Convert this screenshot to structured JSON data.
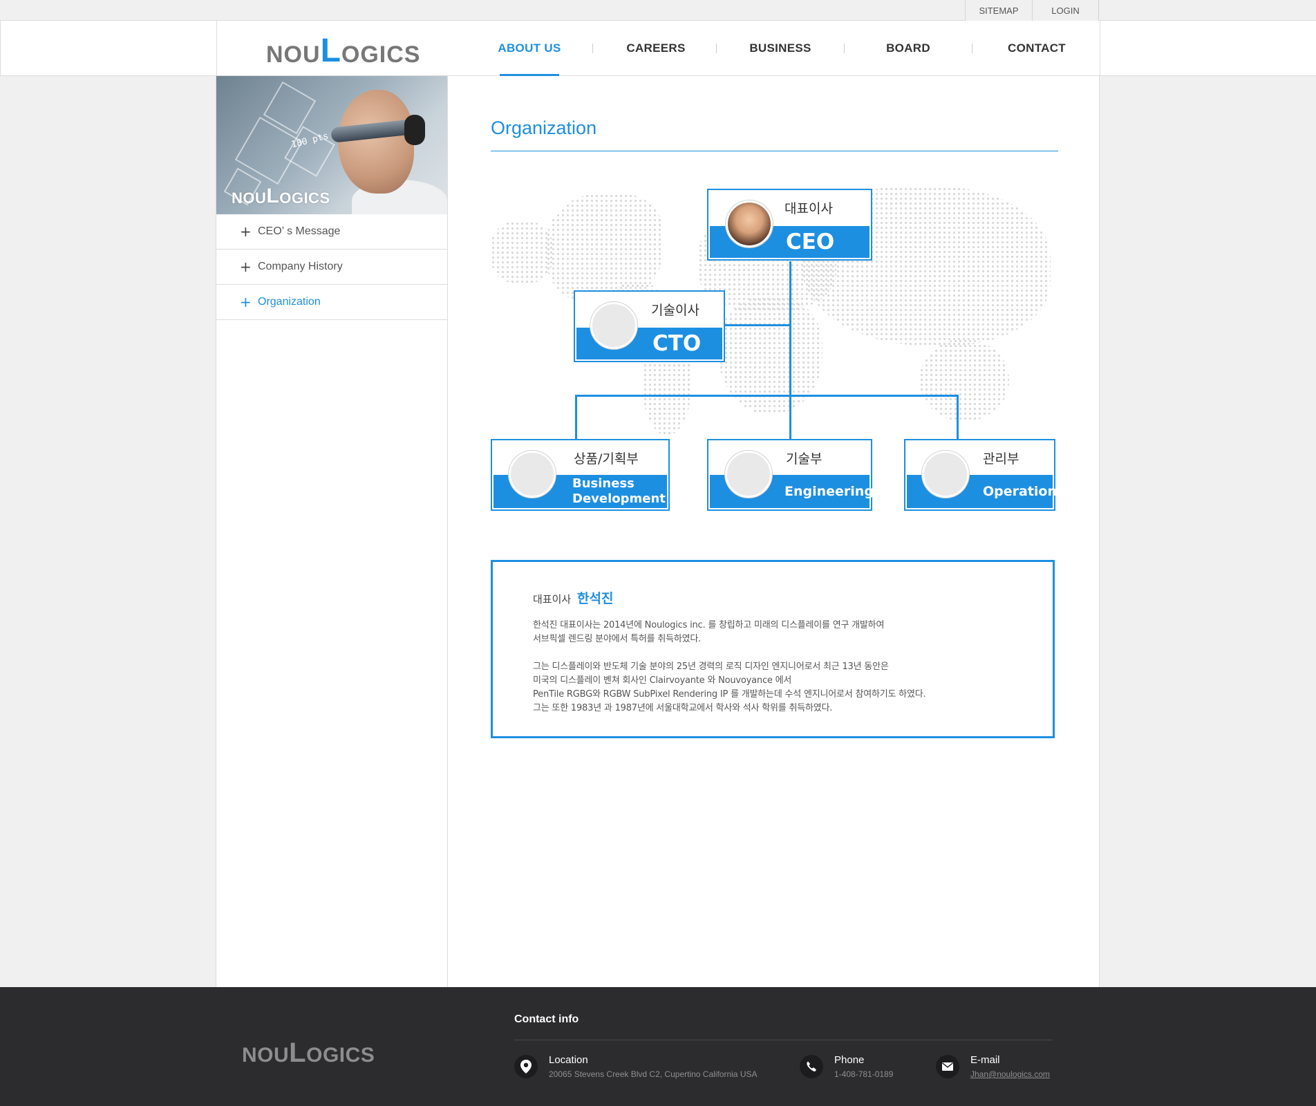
{
  "topbar": {
    "sitemap": "SITEMAP",
    "login": "LOGIN"
  },
  "header": {
    "logo": {
      "part1": "NOU",
      "part2": "L",
      "part3": "OGICS"
    },
    "nav": [
      {
        "label": "ABOUT US",
        "active": true
      },
      {
        "label": "CAREERS",
        "active": false
      },
      {
        "label": "BUSINESS",
        "active": false
      },
      {
        "label": "BOARD",
        "active": false
      },
      {
        "label": "CONTACT",
        "active": false
      }
    ]
  },
  "sidebar": {
    "banner": {
      "overlay_text": "180 pts",
      "logo_part1": "NOU",
      "logo_part2": "L",
      "logo_part3": "OGICS"
    },
    "menu": [
      {
        "label": "CEO’ s Message",
        "active": false
      },
      {
        "label": "Company History",
        "active": false
      },
      {
        "label": "Organization",
        "active": true
      }
    ]
  },
  "main": {
    "title": "Organization",
    "org": {
      "ceo": {
        "kr": "대표이사",
        "en": "CEO"
      },
      "cto": {
        "kr": "기술이사",
        "en": "CTO"
      },
      "biz": {
        "kr": "상품/기획부",
        "en_line1": "Business",
        "en_line2": "Development"
      },
      "eng": {
        "kr": "기술부",
        "en": "Engineering"
      },
      "ops": {
        "kr": "관리부",
        "en": "Operation"
      }
    },
    "bio": {
      "role": "대표이사",
      "name": "한석진",
      "p1_line1": "한석진 대표이사는 2014년에 Noulogics inc. 를 창립하고 미래의 디스플레이를 연구 개발하여",
      "p1_line2": "서브픽셀 렌드링 분야에서 특허를 취득하였다.",
      "p2_line1": "그는 디스플레이와 반도체 기술 분야의 25년 경력의 로직 디자인 엔지니어로서 최근 13년 동안은",
      "p2_line2": "미국의 디스플레이 벤쳐 회사인  Clairvoyante 와  Nouvoyance 에서",
      "p2_line3": "PenTile RGBG와 RGBW SubPixel Rendering IP 를 개발하는데 수석 엔지니어로서 참여하기도 하였다.",
      "p2_line4": "그는 또한 1983년 과 1987년에 서울대학교에서 학사와 석사 학위를 취득하였다."
    }
  },
  "footer": {
    "logo": {
      "part1": "NOU",
      "part2": "L",
      "part3": "OGICS"
    },
    "title": "Contact info",
    "location": {
      "label": "Location",
      "value": "20065 Stevens Creek Blvd C2, Cupertino California USA"
    },
    "phone": {
      "label": "Phone",
      "value": "1-408-781-0189"
    },
    "email": {
      "label": "E-mail",
      "value": "Jhan@noulogics.com"
    }
  },
  "colors": {
    "accent": "#1d8fe1",
    "footer_bg": "#2c2c2e"
  }
}
